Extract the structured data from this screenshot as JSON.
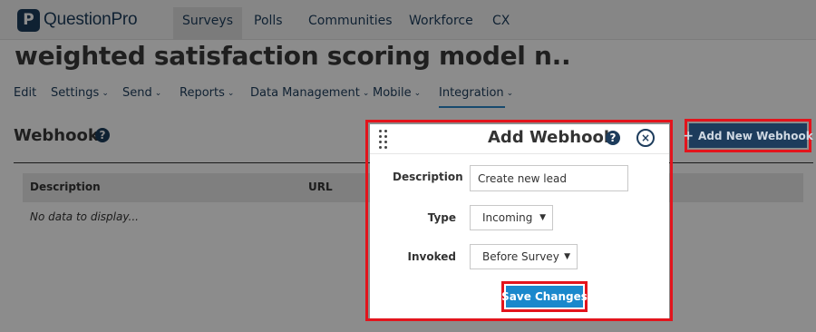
{
  "app": {
    "logo_text": "QuestionPro",
    "logo_mark": "P"
  },
  "topnav": {
    "tabs": [
      {
        "label": "Surveys",
        "active": true
      },
      {
        "label": "Polls",
        "active": false
      },
      {
        "label": "Communities",
        "active": false
      },
      {
        "label": "Workforce",
        "active": false
      },
      {
        "label": "CX",
        "active": false
      }
    ]
  },
  "survey": {
    "title": "weighted satisfaction scoring model n.."
  },
  "subnav": {
    "items": [
      {
        "label": "Edit",
        "has_dropdown": false
      },
      {
        "label": "Settings",
        "has_dropdown": true
      },
      {
        "label": "Send",
        "has_dropdown": true
      },
      {
        "label": "Reports",
        "has_dropdown": true
      },
      {
        "label": "Data Management",
        "has_dropdown": true
      },
      {
        "label": "Mobile",
        "has_dropdown": true
      },
      {
        "label": "Integration",
        "has_dropdown": true,
        "active": true
      }
    ],
    "chevron": "⌄"
  },
  "webhooks": {
    "title": "Webhooks",
    "help_glyph": "?",
    "add_button_label": "Add New Webhook",
    "add_button_icon": "+",
    "table": {
      "columns": [
        "Description",
        "URL"
      ],
      "empty_text": "No data to display..."
    }
  },
  "modal": {
    "title": "Add Webhook",
    "help_glyph": "?",
    "close_glyph": "×",
    "fields": {
      "description": {
        "label": "Description",
        "value": "Create new lead"
      },
      "type": {
        "label": "Type",
        "value": "Incoming"
      },
      "invoked": {
        "label": "Invoked",
        "value": "Before Survey"
      }
    },
    "select_caret": "▼",
    "save_label": "Save Changes"
  },
  "colors": {
    "brand_navy": "#1d3c5c",
    "accent_blue": "#1a88cc",
    "highlight_red": "#e3141c"
  }
}
